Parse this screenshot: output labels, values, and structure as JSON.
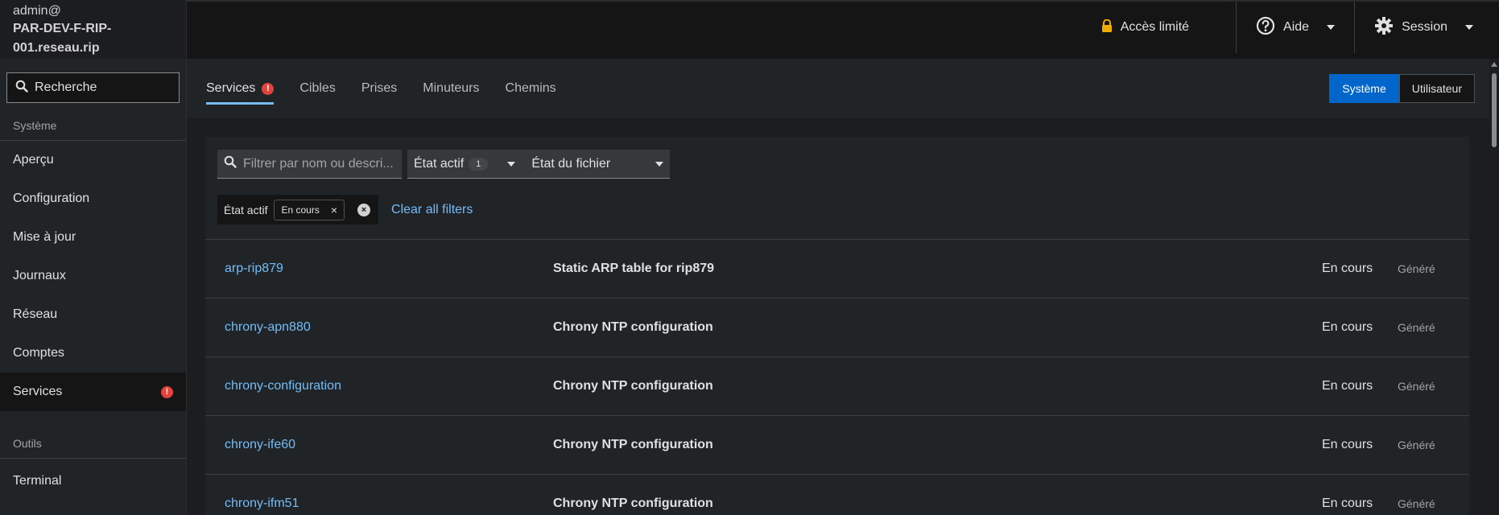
{
  "sidebar": {
    "host_user": "admin@",
    "host_name": "PAR-DEV-F-RIP-001.reseau.rip",
    "search_placeholder": "Recherche",
    "section_system": "Système",
    "items": [
      {
        "label": "Aperçu"
      },
      {
        "label": "Configuration"
      },
      {
        "label": "Mise à jour"
      },
      {
        "label": "Journaux"
      },
      {
        "label": "Réseau"
      },
      {
        "label": "Comptes"
      },
      {
        "label": "Services",
        "badge": "!"
      }
    ],
    "section_tools": "Outils",
    "tools": [
      {
        "label": "Terminal"
      }
    ]
  },
  "topbar": {
    "access": "Accès limité",
    "help": "Aide",
    "session": "Session"
  },
  "tabs": [
    {
      "label": "Services",
      "badge": "!"
    },
    {
      "label": "Cibles"
    },
    {
      "label": "Prises"
    },
    {
      "label": "Minuteurs"
    },
    {
      "label": "Chemins"
    }
  ],
  "toggle": {
    "system": "Système",
    "user": "Utilisateur"
  },
  "filters": {
    "search_placeholder": "Filtrer par nom ou descri...",
    "active_state_label": "État actif",
    "active_state_count": "1",
    "file_state_label": "État du fichier",
    "chip_category": "État actif",
    "chip_value": "En cours",
    "chip_remove": "×",
    "group_remove": "×",
    "clear_all": "Clear all filters"
  },
  "rows": [
    {
      "name": "arp-rip879",
      "desc": "Static ARP table for rip879",
      "state": "En cours",
      "gen": "Généré"
    },
    {
      "name": "chrony-apn880",
      "desc": "Chrony NTP configuration",
      "state": "En cours",
      "gen": "Généré"
    },
    {
      "name": "chrony-configuration",
      "desc": "Chrony NTP configuration",
      "state": "En cours",
      "gen": "Généré"
    },
    {
      "name": "chrony-ife60",
      "desc": "Chrony NTP configuration",
      "state": "En cours",
      "gen": "Généré"
    },
    {
      "name": "chrony-ifm51",
      "desc": "Chrony NTP configuration",
      "state": "En cours",
      "gen": "Généré"
    }
  ],
  "colors": {
    "accent": "#73bcf7",
    "primary": "#0066cc",
    "danger": "#e4433c",
    "lock": "#f0ab00"
  }
}
